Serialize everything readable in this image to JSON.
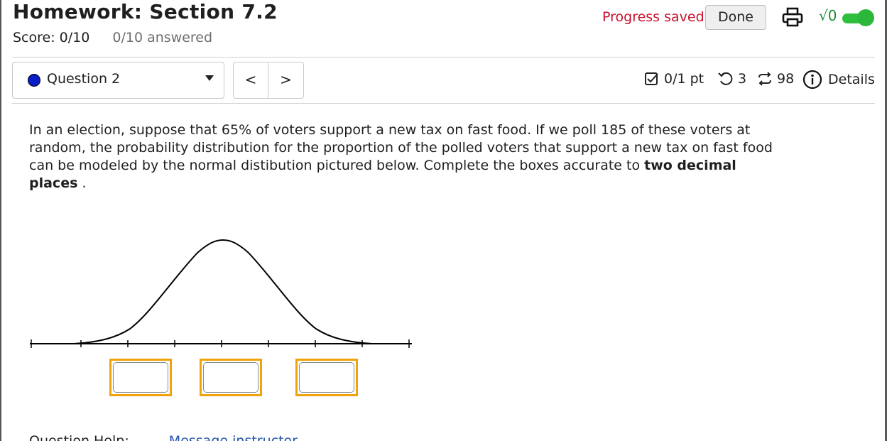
{
  "header": {
    "title": "Homework: Section 7.2",
    "score": "Score: 0/10",
    "answered": "0/10 answered",
    "progress_status": "Progress saved",
    "done_label": "Done",
    "print_icon": "printer-icon",
    "math_toggle_label": "√0",
    "math_toggle_on": true
  },
  "question_nav": {
    "selected": "Question 2",
    "prev_label": "<",
    "next_label": ">",
    "points": "0/1 pt",
    "retries": "3",
    "submissions": "98",
    "details_label": "Details"
  },
  "question": {
    "text_before_bold": "In an election, suppose that 65% of voters support a new tax on fast food. If we poll 185 of these voters at random, the probability distribution for the proportion of the polled voters that support a new tax on fast food can be modeled by the normal distibution pictured below. Complete the boxes accurate to ",
    "bold_text": "two decimal places",
    "text_after_bold": " ."
  },
  "answers": [
    {
      "value": ""
    },
    {
      "value": ""
    },
    {
      "value": ""
    }
  ],
  "footer": {
    "help_label": "Question Help:",
    "help_link": "Message instructor"
  },
  "colors": {
    "progress": "#c8102e",
    "answer_border": "#f0a30a",
    "question_dot": "#0a1ec8",
    "toggle": "#2fbf3f"
  }
}
